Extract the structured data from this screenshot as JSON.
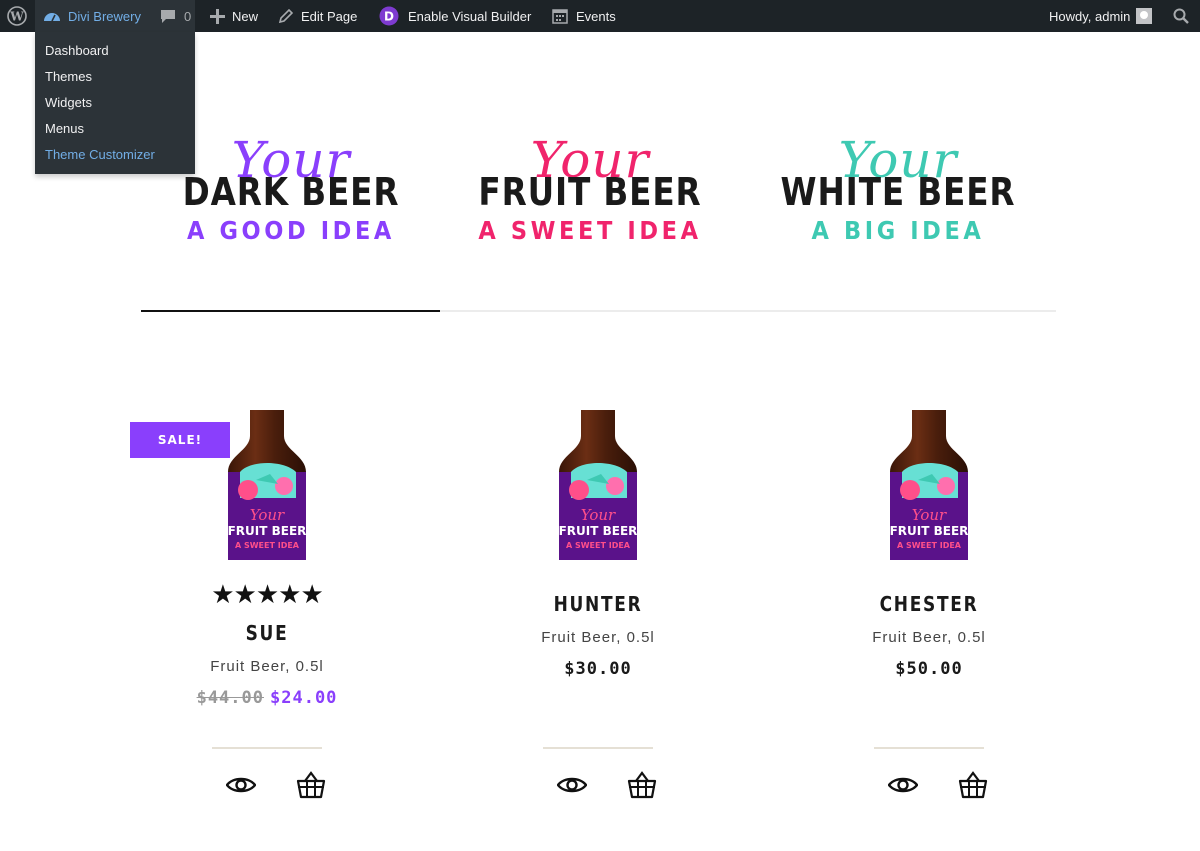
{
  "adminbar": {
    "site_name": "Divi Brewery",
    "comments_count": "0",
    "new_label": "New",
    "edit_label": "Edit Page",
    "visual_builder_label": "Enable Visual Builder",
    "events_label": "Events",
    "howdy_label": "Howdy, admin",
    "site_menu": [
      "Dashboard",
      "Themes",
      "Widgets",
      "Menus",
      "Theme Customizer"
    ]
  },
  "tabs": [
    {
      "script": "Your",
      "title": "DARK BEER",
      "subtitle": "A GOOD IDEA",
      "color": "#8a3ffc"
    },
    {
      "script": "Your",
      "title": "FRUIT BEER",
      "subtitle": "A SWEET IDEA",
      "color": "#f0246c"
    },
    {
      "script": "Your",
      "title": "WHITE BEER",
      "subtitle": "A BIG IDEA",
      "color": "#3ec9b2"
    }
  ],
  "products": [
    {
      "name": "SUE",
      "category": "Fruit Beer, 0.5l",
      "old_price": "$44.00",
      "price": "$24.00",
      "sale_label": "SALE!",
      "rating": 5,
      "stars": "★★★★★"
    },
    {
      "name": "HUNTER",
      "category": "Fruit Beer, 0.5l",
      "price": "$30.00"
    },
    {
      "name": "CHESTER",
      "category": "Fruit Beer, 0.5l",
      "price": "$50.00"
    }
  ],
  "bottle_label": {
    "script": "Your",
    "line1": "FRUIT BEER",
    "line2": "A SWEET IDEA"
  },
  "icons": [
    "wordpress-icon",
    "dashboard-icon",
    "comment-icon",
    "plus-icon",
    "pencil-icon",
    "divi-icon",
    "calendar-icon",
    "search-icon",
    "eye-icon",
    "basket-icon",
    "star-icon"
  ]
}
